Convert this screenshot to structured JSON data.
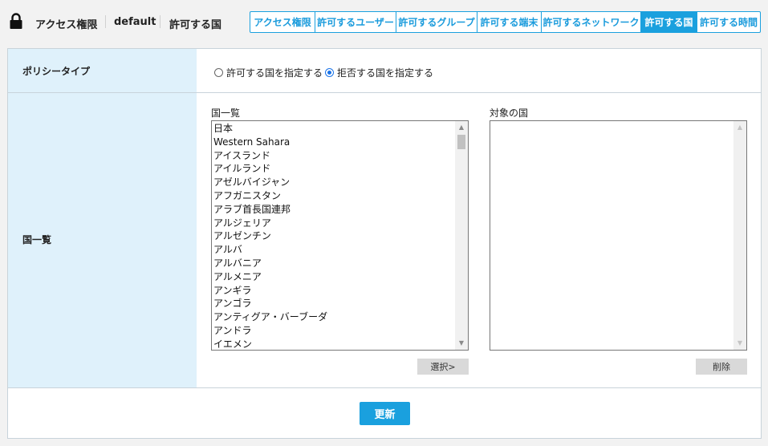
{
  "breadcrumb": [
    "アクセス権限",
    "default",
    "許可する国"
  ],
  "tabs": [
    {
      "label": "アクセス権限",
      "active": false
    },
    {
      "label": "許可するユーザー",
      "active": false
    },
    {
      "label": "許可するグループ",
      "active": false
    },
    {
      "label": "許可する端末",
      "active": false
    },
    {
      "label": "許可するネットワーク",
      "active": false
    },
    {
      "label": "許可する国",
      "active": true
    },
    {
      "label": "許可する時間",
      "active": false
    }
  ],
  "policy": {
    "label": "ポリシータイプ",
    "options": [
      {
        "label": "許可する国を指定する",
        "checked": false
      },
      {
        "label": "拒否する国を指定する",
        "checked": true
      }
    ]
  },
  "countries": {
    "row_label": "国一覧",
    "list_label": "国一覧",
    "items": [
      "日本",
      "Western Sahara",
      "アイスランド",
      "アイルランド",
      "アゼルバイジャン",
      "アフガニスタン",
      "アラブ首長国連邦",
      "アルジェリア",
      "アルゼンチン",
      "アルバ",
      "アルバニア",
      "アルメニア",
      "アンギラ",
      "アンゴラ",
      "アンティグア・バーブーダ",
      "アンドラ",
      "イエメン"
    ],
    "select_button": "選択>",
    "target_label": "対象の国",
    "target_items": [],
    "delete_button": "削除"
  },
  "update_button": "更新",
  "colors": {
    "accent": "#1aa0de",
    "label_bg": "#dff1fb"
  }
}
